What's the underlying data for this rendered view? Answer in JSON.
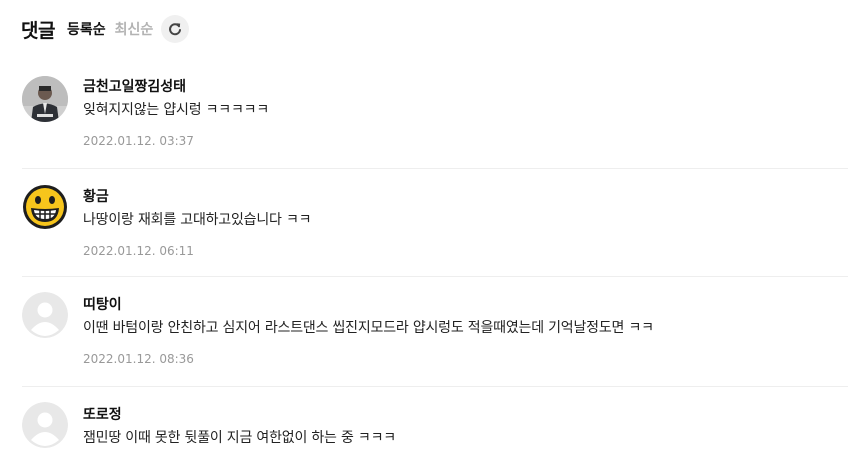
{
  "header": {
    "title": "댓글",
    "sort_registered": "등록순",
    "sort_latest": "최신순"
  },
  "comments": [
    {
      "author": "금천고일짱김성태",
      "text": "잊혀지지않는 얍시렁 ㅋㅋㅋㅋㅋ",
      "date": "2022.01.12. 03:37",
      "avatar": "photo-avatar"
    },
    {
      "author": "황금",
      "text": "나땅이랑 재회를 고대하고있습니다 ㅋㅋ",
      "date": "2022.01.12. 06:11",
      "avatar": "grinning-emoji-avatar"
    },
    {
      "author": "띠탕이",
      "text": "이땐 바텀이랑 안친하고 심지어 라스트댄스 씹진지모드라 얍시렁도 적을때였는데 기억날정도면 ㅋㅋ",
      "date": "2022.01.12. 08:36",
      "avatar": "default-avatar"
    },
    {
      "author": "또로정",
      "text": "잼민땅 이때 못한 뒷풀이 지금 여한없이 하는 중 ㅋㅋㅋ",
      "date": "",
      "avatar": "default-avatar"
    }
  ]
}
